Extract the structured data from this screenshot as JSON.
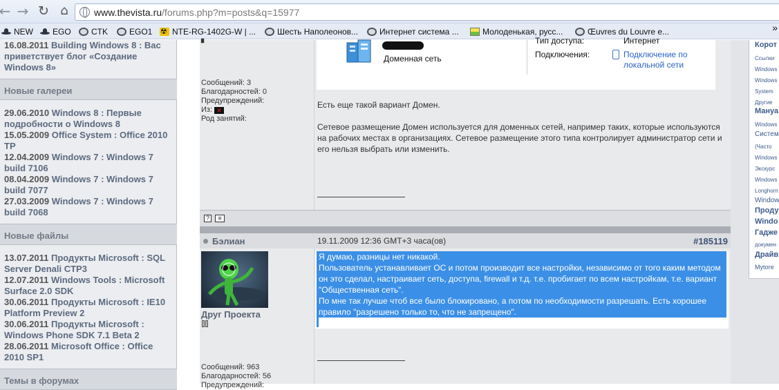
{
  "browser": {
    "url_domain": "www.thevista.ru",
    "url_rest": "/forums.php?m=posts&q=15977",
    "bookmarks": [
      {
        "label": "NEW",
        "icon": "hat-icon"
      },
      {
        "label": "EGO",
        "icon": "hat-icon"
      },
      {
        "label": "CTK",
        "icon": "globe-icon"
      },
      {
        "label": "EGO1",
        "icon": "globe-icon"
      },
      {
        "label": "NTE-RG-1402G-W | ...",
        "icon": "radiation-icon"
      },
      {
        "label": "Шесть Наполеонов...",
        "icon": "globe-icon"
      },
      {
        "label": "Интернет система ...",
        "icon": "globe-icon"
      },
      {
        "label": "Молоденькая, русс...",
        "icon": "image-icon"
      },
      {
        "label": "Œuvres du Louvre e...",
        "icon": "globe-icon"
      }
    ],
    "more": "»"
  },
  "left": {
    "top_news": {
      "date": "16.08.2011",
      "title": "Building Windows 8 : Вас приветствует блог «Создание Windows 8»"
    },
    "galleries_head": "Новые галереи",
    "galleries": [
      {
        "date": "29.06.2010",
        "title": "Windows 8 : Первые подробности о Windows 8"
      },
      {
        "date": "15.05.2009",
        "title": "Office System : Office 2010 TP"
      },
      {
        "date": "12.04.2009",
        "title": "Windows 7 : Windows 7 build 7106"
      },
      {
        "date": "08.04.2009",
        "title": "Windows 7 : Windows 7 build 7077"
      },
      {
        "date": "27.03.2009",
        "title": "Windows 7 : Windows 7 build 7068"
      }
    ],
    "files_head": "Новые файлы",
    "files": [
      {
        "date": "13.07.2011",
        "title": "Продукты Microsoft : SQL Server Denali CTP3"
      },
      {
        "date": "12.07.2011",
        "title": "Windows Tools : Microsoft Surface 2.0 SDK"
      },
      {
        "date": "30.06.2011",
        "title": "Продукты Microsoft : IE10 Platform Preview 2"
      },
      {
        "date": "30.06.2011",
        "title": "Продукты Microsoft : Windows Phone SDK 7.1 Beta 2"
      },
      {
        "date": "28.06.2011",
        "title": "Microsoft Office : Office 2010 SP1"
      }
    ],
    "forums_head": "Темы в форумах"
  },
  "postA": {
    "stats": [
      "Сообщений: 3",
      "Благодарностей: 0",
      "Предупреждений:",
      "Из:",
      "Род занятий:"
    ],
    "image": {
      "network_label": "Доменная сеть",
      "access_label": "Тип доступа:",
      "access_value": "Интернет",
      "conn_label": "Подключения:",
      "conn_link": "Подключение по локальной сети"
    },
    "paragraphs": [
      "Есть еще такой вариант Домен.",
      "Сетевое размещение Домен используется для доменных сетей, например таких, которые используются на рабочих местах в организациях. Сетевое размещение этого типа контролирует администратор сети и его нельзя выбрать или изменить."
    ]
  },
  "postB": {
    "user": "Бэлиан",
    "date": "19.11.2009 12:36 GMT+3 часа(ов)",
    "number": "#185119",
    "rank": "Друг Проекта",
    "stats": [
      "Сообщений: 963",
      "Благодарностей: 56",
      "Предупреждений:"
    ],
    "lines": [
      "Я думаю, разницы нет никакой.",
      "Пользователь устанавливает ОС и потом производит все настройки, независимо от того каким методом он это сделал, настраивает сеть, доступа, firewall и т.д. т.е. пробигает по всем настройкам, т.е. вариант \"Общественная сеть\".",
      "По мне так лучше чтоб все было блокировано, а потом по необходимости разрешать. Есть хорошее правило \"разрешено только то, что не запрещено\"."
    ]
  },
  "right": {
    "items": [
      "Корот",
      "Ссылки",
      "Windows",
      "Windows",
      "System",
      "Другие",
      "Мануа",
      "Windows",
      "Систем",
      "(Часто",
      "Windows",
      "Экскурс",
      "Windows",
      "Longhorn",
      "Window",
      "Проду",
      "Windo",
      "Гадже",
      "докумен",
      "Драйв",
      "Mytoге"
    ]
  }
}
